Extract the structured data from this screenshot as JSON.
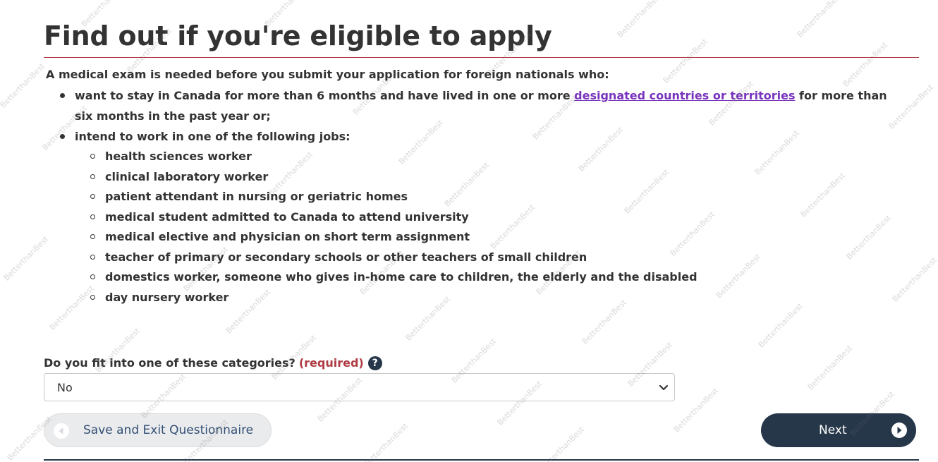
{
  "page": {
    "title": "Find out if you're eligible to apply",
    "intro": "A medical exam is needed before you submit your application for foreign nationals who:",
    "bullet1_before_link": "want to stay in Canada for more than 6 months  and have lived in one or more ",
    "bullet1_link": "designated countries or territories",
    "bullet1_after_link": " for more than six months in the past year or;",
    "bullet2": "intend to work in one of the following jobs:",
    "jobs": [
      "health sciences worker",
      "clinical laboratory worker",
      "patient attendant in nursing or geriatric homes",
      "medical student admitted to Canada to attend university",
      "medical elective and physician on short term assignment",
      "teacher of primary or secondary schools or other teachers of small children",
      "domestics worker, someone  who gives in-home care to children, the elderly and the disabled",
      "day nursery worker"
    ]
  },
  "question": {
    "label": "Do you fit into one of these categories?",
    "required": "(required)",
    "help_icon": "question-circle-icon",
    "selected": "No"
  },
  "buttons": {
    "save_label": "Save and Exit Questionnaire",
    "next_label": "Next"
  },
  "watermark": {
    "text": "BetterthanBest"
  },
  "colors": {
    "accent_red": "#af3c43",
    "link": "#7834bc",
    "dark_blue": "#26374a",
    "secondary_text": "#335075"
  }
}
